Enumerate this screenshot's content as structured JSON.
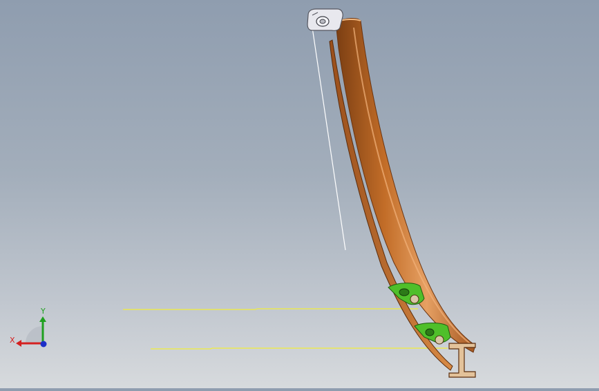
{
  "viewport": {
    "description_label": "",
    "triad": {
      "x_label": "X",
      "y_label": "Y",
      "x_color": "#d42020",
      "y_color": "#1fa01f",
      "z_color": "#1c2fc8"
    },
    "colors": {
      "bg_top": "#8f9daf",
      "bg_bottom": "#d7dadd",
      "rail": "#c26d28",
      "rail_dark": "#7b3e12",
      "rail_light": "#e6a063",
      "bracket": "#4fbf2a",
      "guide_line": "#f2ee3a",
      "thread_line": "#ffffff",
      "tensioner": "#e8e8ee"
    }
  }
}
